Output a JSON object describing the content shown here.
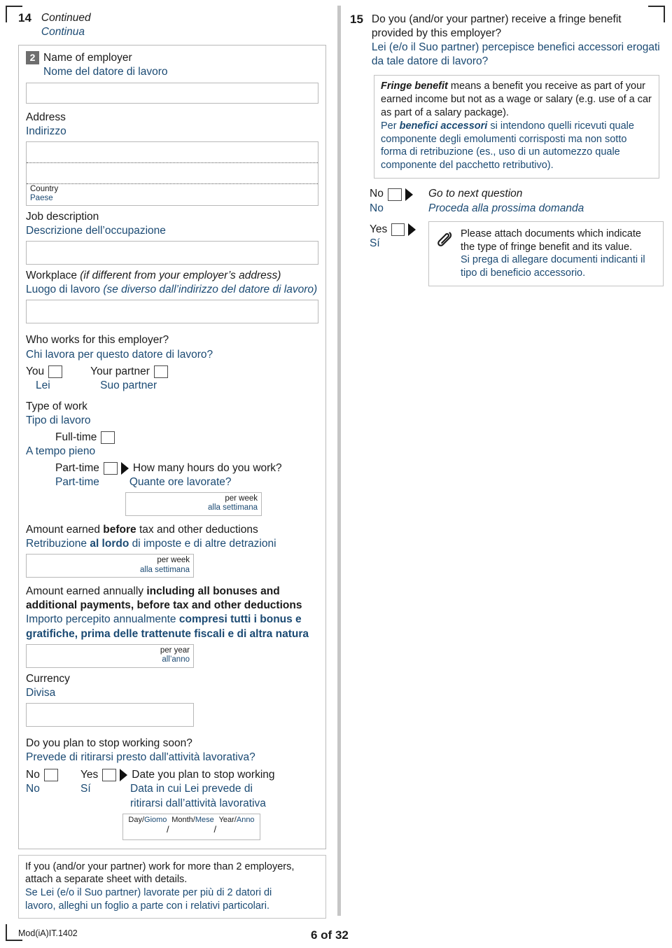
{
  "footer": {
    "mod_code": "Mod(iA)IT.1402",
    "page_number": "6 of 32"
  },
  "left_column": {
    "question_number": "14",
    "continued_en": "Continued",
    "continued_it": "Continua",
    "employer_block": {
      "badge": "2",
      "name_en": "Name of employer",
      "name_it": "Nome del datore di lavoro",
      "address_en": "Address",
      "address_it": "Indirizzo",
      "country_en": "Country",
      "country_it": "Paese",
      "job_desc_en": "Job description",
      "job_desc_it": "Descrizione dell’occupazione",
      "workplace_en_main": "Workplace",
      "workplace_en_paren": "(if different from your employer’s address)",
      "workplace_it_main": "Luogo di lavoro",
      "workplace_it_paren": "(se diverso dall’indirizzo del datore di lavoro)"
    },
    "who_works": {
      "question_en": "Who works for this employer?",
      "question_it": "Chi lavora per questo datore di lavoro?",
      "you_en": "You",
      "you_it": "Lei",
      "partner_en": "Your partner",
      "partner_it": "Suo partner"
    },
    "type_of_work": {
      "label_en": "Type of work",
      "label_it": "Tipo di lavoro",
      "fulltime_en": "Full-time",
      "fulltime_it": "A tempo pieno",
      "parttime_en": "Part-time",
      "parttime_it": "Part-time",
      "hours_question_en": "How many hours do you work?",
      "hours_question_it": "Quante ore lavorate?",
      "per_week_en": "per week",
      "per_week_it": "alla settimana"
    },
    "earnings_before": {
      "en_pre": "Amount earned ",
      "en_bold": "before",
      "en_post": " tax and other deductions",
      "it_pre": "Retribuzione ",
      "it_bold": "al lordo",
      "it_post": " di imposte e di altre detrazioni",
      "per_week_en": "per week",
      "per_week_it": "alla settimana"
    },
    "earnings_annual": {
      "en_pre": "Amount earned annually ",
      "en_bold": "including all bonuses and additional payments, before tax and other deductions",
      "it_pre": "Importo percepito annualmente ",
      "it_bold": "compresi tutti i bonus e gratifiche, prima delle trattenute fiscali e di altra natura",
      "per_year_en": "per year",
      "per_year_it": "all’anno"
    },
    "currency": {
      "label_en": "Currency",
      "label_it": "Divisa"
    },
    "stop_working": {
      "question_en": "Do you plan to stop working soon?",
      "question_it": "Prevede di ritirarsi presto dall'attività lavorativa?",
      "no_en": "No",
      "no_it": "No",
      "yes_en": "Yes",
      "yes_it": "Sí",
      "date_label_en": "Date you plan to stop working",
      "date_label_it_line1": "Data in cui Lei prevede di",
      "date_label_it_line2": "ritirarsi dall’attività lavorativa",
      "date_day_en": "Day/",
      "date_day_it": "Giomo",
      "date_month_en": "Month/",
      "date_month_it": "Mese",
      "date_year_en": "Year/",
      "date_year_it": "Anno",
      "slash": "/"
    },
    "note": {
      "en_line1": "If you (and/or your partner) work for more than 2 employers,",
      "en_line2": "attach a separate sheet with details.",
      "it_line1": "Se Lei (e/o il Suo partner) lavorate per più di 2 datori di",
      "it_line2": "lavoro, alleghi un foglio a parte con i relativi particolari."
    }
  },
  "right_column": {
    "question_number": "15",
    "question_en": "Do you (and/or your partner) receive a fringe benefit provided by this employer?",
    "question_it": "Lei (e/o il Suo partner) percepisce benefici accessori erogati da tale datore di lavoro?",
    "definition": {
      "en_bold": "Fringe benefit",
      "en_rest": " means a benefit you receive as part of your earned income but not as a wage or salary (e.g. use of a car as part of a salary package).",
      "it_pre": "Per ",
      "it_bold": "benefici accessori",
      "it_rest": " si intendono quelli ricevuti quale componente degli emolumenti corrisposti ma non sotto forma di retribuzione (es., uso di un automezzo quale componente del pacchetto retributivo)."
    },
    "answers": {
      "no_en": "No",
      "no_it": "No",
      "goto_en": "Go to next question",
      "goto_it": "Proceda alla prossima domanda",
      "yes_en": "Yes",
      "yes_it": "Sí",
      "attach_en": "Please attach documents which indicate the type of fringe benefit and its value.",
      "attach_it": "Si prega di allegare documenti indicanti il tipo di beneficio accessorio."
    }
  },
  "colors": {
    "italian_text": "#1b4a73",
    "english_text": "#1a1a1a",
    "badge_bg": "#6e6e6e",
    "box_border": "#b9b9b9"
  }
}
